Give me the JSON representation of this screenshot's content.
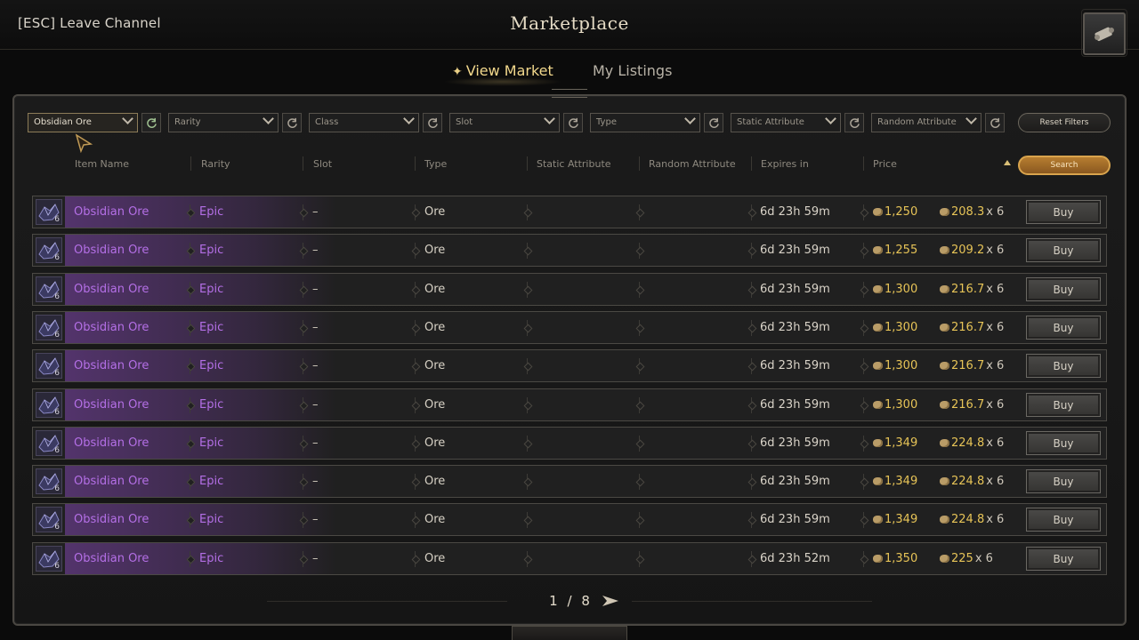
{
  "header": {
    "esc_label": "[ESC] Leave Channel",
    "title": "Marketplace",
    "map_icon": "map-scroll-icon"
  },
  "tabs": [
    {
      "label": "View Market",
      "active": true
    },
    {
      "label": "My Listings",
      "active": false
    }
  ],
  "filters": [
    {
      "value": "Obsidian Ore",
      "active": true
    },
    {
      "value": "Rarity",
      "active": false
    },
    {
      "value": "Class",
      "active": false
    },
    {
      "value": "Slot",
      "active": false
    },
    {
      "value": "Type",
      "active": false
    },
    {
      "value": "Static Attribute",
      "active": false
    },
    {
      "value": "Random Attribute",
      "active": false
    }
  ],
  "reset_label": "Reset Filters",
  "search_label": "Search",
  "columns": [
    "Item Name",
    "Rarity",
    "Slot",
    "Type",
    "Static Attribute",
    "Random Attribute",
    "Expires in",
    "Price"
  ],
  "rows": [
    {
      "name": "Obsidian Ore",
      "qty": "6",
      "rarity": "Epic",
      "slot": "–",
      "type": "Ore",
      "expires": "6d 23h 59m",
      "price": "1,250",
      "unit": "208.3",
      "mult": "x 6",
      "buy": "Buy"
    },
    {
      "name": "Obsidian Ore",
      "qty": "6",
      "rarity": "Epic",
      "slot": "–",
      "type": "Ore",
      "expires": "6d 23h 59m",
      "price": "1,255",
      "unit": "209.2",
      "mult": "x 6",
      "buy": "Buy"
    },
    {
      "name": "Obsidian Ore",
      "qty": "6",
      "rarity": "Epic",
      "slot": "–",
      "type": "Ore",
      "expires": "6d 23h 59m",
      "price": "1,300",
      "unit": "216.7",
      "mult": "x 6",
      "buy": "Buy"
    },
    {
      "name": "Obsidian Ore",
      "qty": "6",
      "rarity": "Epic",
      "slot": "–",
      "type": "Ore",
      "expires": "6d 23h 59m",
      "price": "1,300",
      "unit": "216.7",
      "mult": "x 6",
      "buy": "Buy"
    },
    {
      "name": "Obsidian Ore",
      "qty": "6",
      "rarity": "Epic",
      "slot": "–",
      "type": "Ore",
      "expires": "6d 23h 59m",
      "price": "1,300",
      "unit": "216.7",
      "mult": "x 6",
      "buy": "Buy"
    },
    {
      "name": "Obsidian Ore",
      "qty": "6",
      "rarity": "Epic",
      "slot": "–",
      "type": "Ore",
      "expires": "6d 23h 59m",
      "price": "1,300",
      "unit": "216.7",
      "mult": "x 6",
      "buy": "Buy"
    },
    {
      "name": "Obsidian Ore",
      "qty": "6",
      "rarity": "Epic",
      "slot": "–",
      "type": "Ore",
      "expires": "6d 23h 59m",
      "price": "1,349",
      "unit": "224.8",
      "mult": "x 6",
      "buy": "Buy"
    },
    {
      "name": "Obsidian Ore",
      "qty": "6",
      "rarity": "Epic",
      "slot": "–",
      "type": "Ore",
      "expires": "6d 23h 59m",
      "price": "1,349",
      "unit": "224.8",
      "mult": "x 6",
      "buy": "Buy"
    },
    {
      "name": "Obsidian Ore",
      "qty": "6",
      "rarity": "Epic",
      "slot": "–",
      "type": "Ore",
      "expires": "6d 23h 59m",
      "price": "1,349",
      "unit": "224.8",
      "mult": "x 6",
      "buy": "Buy"
    },
    {
      "name": "Obsidian Ore",
      "qty": "6",
      "rarity": "Epic",
      "slot": "–",
      "type": "Ore",
      "expires": "6d 23h 52m",
      "price": "1,350",
      "unit": "225",
      "mult": "x 6",
      "buy": "Buy"
    }
  ],
  "pager": {
    "current": "1",
    "sep": "/",
    "total": "8"
  },
  "colors": {
    "epic": "#b46fe6",
    "gold": "#e7c457",
    "accent": "#d9a44d"
  }
}
